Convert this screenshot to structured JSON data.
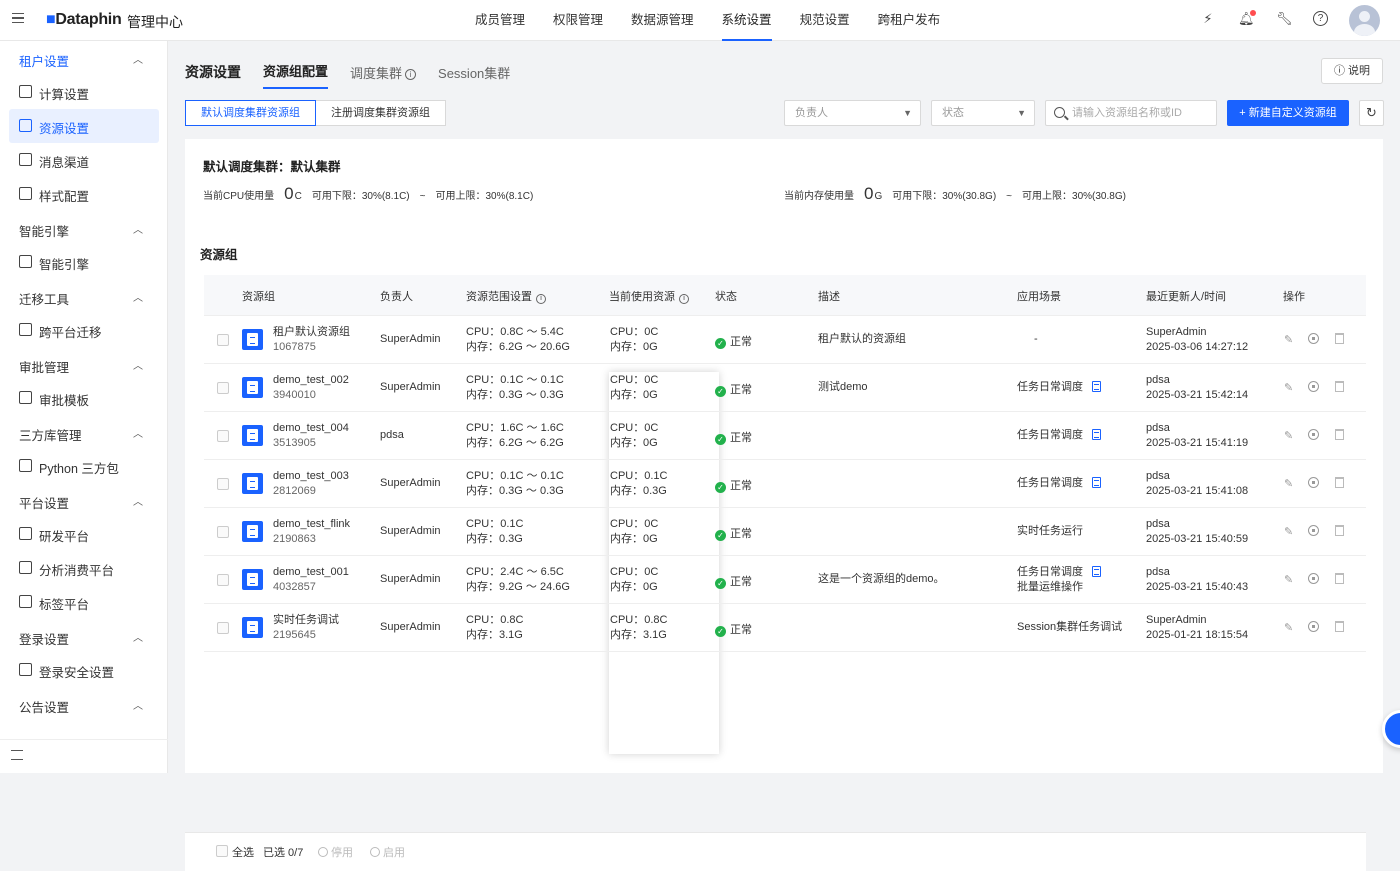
{
  "header": {
    "logo_text": "Dataphin",
    "app_title": "管理中心",
    "nav": [
      "成员管理",
      "权限管理",
      "数据源管理",
      "系统设置",
      "规范设置",
      "跨租户发布"
    ],
    "active_nav": "系统设置"
  },
  "sidebar": {
    "groups": [
      {
        "label": "租户设置",
        "items": [
          "计算设置",
          "资源设置",
          "消息渠道",
          "样式配置"
        ]
      },
      {
        "label": "智能引擎",
        "items": [
          "智能引擎"
        ]
      },
      {
        "label": "迁移工具",
        "items": [
          "跨平台迁移"
        ]
      },
      {
        "label": "审批管理",
        "items": [
          "审批模板"
        ]
      },
      {
        "label": "三方库管理",
        "items": [
          "Python 三方包"
        ]
      },
      {
        "label": "平台设置",
        "items": [
          "研发平台",
          "分析消费平台",
          "标签平台"
        ]
      },
      {
        "label": "登录设置",
        "items": [
          "登录安全设置"
        ]
      },
      {
        "label": "公告设置",
        "items": []
      }
    ],
    "active_item": "资源设置"
  },
  "tabs": {
    "title": "资源设置",
    "items": [
      "资源组配置",
      "调度集群",
      "Session集群"
    ],
    "active": "资源组配置"
  },
  "help_label": "说明",
  "segments": [
    "默认调度集群资源组",
    "注册调度集群资源组"
  ],
  "filters": {
    "owner_placeholder": "负责人",
    "status_placeholder": "状态",
    "search_placeholder": "请输入资源组名称或ID"
  },
  "create_button": "新建自定义资源组",
  "cluster": {
    "title": "默认调度集群：默认集群",
    "cpu_label": "当前CPU使用量",
    "cpu_value": "0",
    "cpu_unit": "C",
    "cpu_min": "可用下限：30%(8.1C)",
    "cpu_max": "可用上限：30%(8.1C)",
    "mem_label": "当前内存使用量",
    "mem_value": "0",
    "mem_unit": "G",
    "mem_min": "可用下限：30%(30.8G)",
    "mem_max": "可用上限：30%(30.8G)",
    "sep": "~"
  },
  "resource_group_title": "资源组",
  "table": {
    "headers": [
      "资源组",
      "负责人",
      "资源范围设置",
      "当前使用资源",
      "状态",
      "描述",
      "应用场景",
      "最近更新人/时间",
      "操作"
    ],
    "rows": [
      {
        "name": "租户默认资源组",
        "id": "1067875",
        "owner": "SuperAdmin",
        "range_cpu": "CPU：0.8C ～ 5.4C",
        "range_mem": "内存：6.2G ～ 20.6G",
        "use_cpu": "CPU：0C",
        "use_mem": "内存：0G",
        "status": "正常",
        "desc": "租户默认的资源组",
        "scene": "-",
        "scene2": "",
        "scene_doc": false,
        "updater": "SuperAdmin",
        "time": "2025-03-06 14:27:12"
      },
      {
        "name": "demo_test_002",
        "id": "3940010",
        "owner": "SuperAdmin",
        "range_cpu": "CPU：0.1C ～ 0.1C",
        "range_mem": "内存：0.3G ～ 0.3G",
        "use_cpu": "CPU：0C",
        "use_mem": "内存：0G",
        "status": "正常",
        "desc": "测试demo",
        "scene": "任务日常调度",
        "scene2": "",
        "scene_doc": true,
        "updater": "pdsa",
        "time": "2025-03-21 15:42:14"
      },
      {
        "name": "demo_test_004",
        "id": "3513905",
        "owner": "pdsa",
        "range_cpu": "CPU：1.6C ～ 1.6C",
        "range_mem": "内存：6.2G ～ 6.2G",
        "use_cpu": "CPU：0C",
        "use_mem": "内存：0G",
        "status": "正常",
        "desc": "",
        "scene": "任务日常调度",
        "scene2": "",
        "scene_doc": true,
        "updater": "pdsa",
        "time": "2025-03-21 15:41:19"
      },
      {
        "name": "demo_test_003",
        "id": "2812069",
        "owner": "SuperAdmin",
        "range_cpu": "CPU：0.1C ～ 0.1C",
        "range_mem": "内存：0.3G ～ 0.3G",
        "use_cpu": "CPU：0.1C",
        "use_mem": "内存：0.3G",
        "status": "正常",
        "desc": "",
        "scene": "任务日常调度",
        "scene2": "",
        "scene_doc": true,
        "updater": "pdsa",
        "time": "2025-03-21 15:41:08"
      },
      {
        "name": "demo_test_flink",
        "id": "2190863",
        "owner": "SuperAdmin",
        "range_cpu": "CPU：0.1C",
        "range_mem": "内存：0.3G",
        "use_cpu": "CPU：0C",
        "use_mem": "内存：0G",
        "status": "正常",
        "desc": "",
        "scene": "实时任务运行",
        "scene2": "",
        "scene_doc": false,
        "updater": "pdsa",
        "time": "2025-03-21 15:40:59"
      },
      {
        "name": "demo_test_001",
        "id": "4032857",
        "owner": "SuperAdmin",
        "range_cpu": "CPU：2.4C ～ 6.5C",
        "range_mem": "内存：9.2G ～ 24.6G",
        "use_cpu": "CPU：0C",
        "use_mem": "内存：0G",
        "status": "正常",
        "desc": "这是一个资源组的demo。",
        "scene": "任务日常调度",
        "scene2": "批量运维操作",
        "scene_doc": true,
        "updater": "pdsa",
        "time": "2025-03-21 15:40:43"
      },
      {
        "name": "实时任务调试",
        "id": "2195645",
        "owner": "SuperAdmin",
        "range_cpu": "CPU：0.8C",
        "range_mem": "内存：3.1G",
        "use_cpu": "CPU：0.8C",
        "use_mem": "内存：3.1G",
        "status": "正常",
        "desc": "",
        "scene": "Session集群任务调试",
        "scene2": "",
        "scene_doc": false,
        "updater": "SuperAdmin",
        "time": "2025-01-21 18:15:54"
      }
    ]
  },
  "footer": {
    "select_all": "全选",
    "selected": "已选 0/7",
    "disable": "停用",
    "enable": "启用"
  },
  "colors": {
    "accent": "#1a62ff",
    "success": "#22b14c",
    "alert": "#ff4d4f"
  }
}
